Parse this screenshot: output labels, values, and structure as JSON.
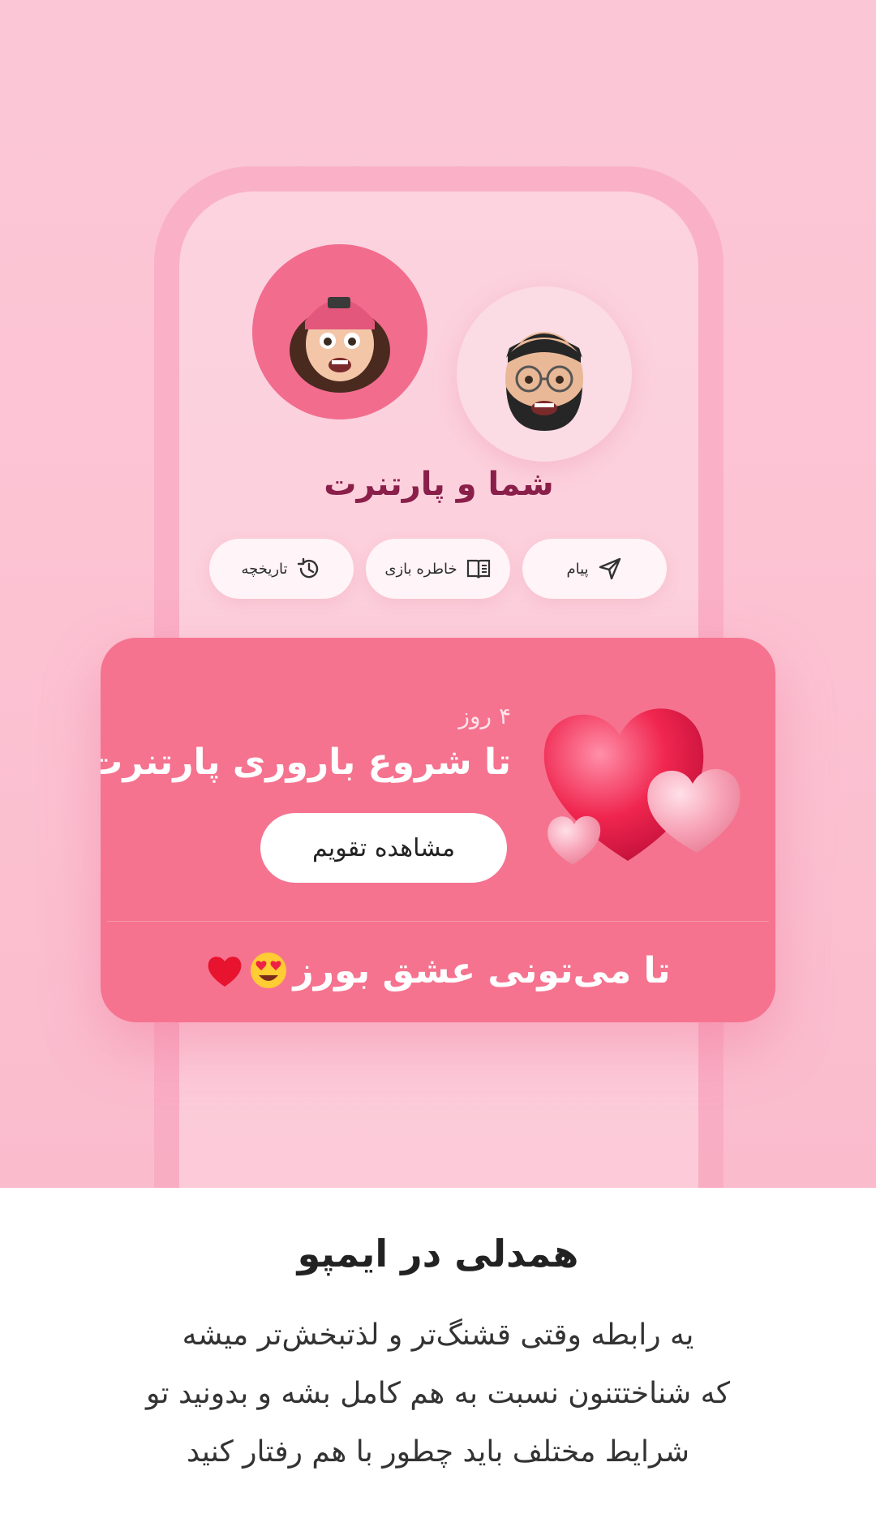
{
  "hero": {
    "partner_name": "شما و پارتنرت",
    "quick_actions": [
      {
        "label": "پیام",
        "icon": "send-icon"
      },
      {
        "label": "خاطره بازی",
        "icon": "book-icon"
      },
      {
        "label": "تاریخچه",
        "icon": "history-icon"
      }
    ]
  },
  "card": {
    "days_label": "۴ روز",
    "title": "تا شروع باروری پارتنرت",
    "calendar_button": "مشاهده تقویم",
    "footer_text": "تا می‌تونی عشق بورز",
    "footer_emojis": [
      "heart-eyes-emoji",
      "red-heart-emoji"
    ]
  },
  "content": {
    "heading": "همدلی در ایمپو",
    "lines": [
      "یه رابطه وقتی قشنگ‌تر و لذتبخش‌تر میشه",
      "که شناختتنون نسبت به هم کامل بشه و بدونید تو",
      "شرایط مختلف باید چطور با هم رفتار کنید"
    ]
  },
  "colors": {
    "hero_bg": "#fbc7d6",
    "card_bg": "#f5738f",
    "partner_avatar_bg": "#f26c8e",
    "name_color": "#8a1f4a"
  }
}
